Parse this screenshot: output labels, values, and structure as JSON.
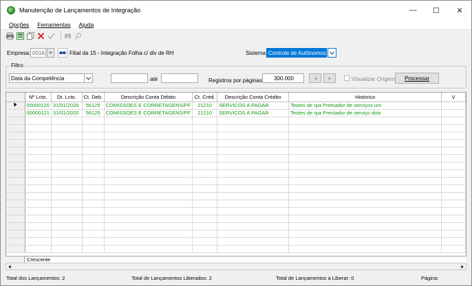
{
  "window": {
    "title": "Manutenção de Lançamentos de Integração",
    "minimize": "—",
    "maximize": "☐",
    "close": "✕"
  },
  "menu": [
    {
      "label": "Opções",
      "key": "O"
    },
    {
      "label": "Ferramentas",
      "key": "F"
    },
    {
      "label": "Ajuda",
      "key": "A"
    }
  ],
  "toolbar": {
    "icons": [
      "printer-icon",
      "export-icon",
      "copy-icon",
      "delete-icon",
      "confirm-icon",
      "binoculars-icon",
      "search-icon"
    ]
  },
  "empresa": {
    "label": "Empresa:",
    "code": "0016",
    "filial": "Filial da 15 - Integração Folha  c/ div de RH"
  },
  "sistema": {
    "label": "Sistema:",
    "value": "Controle de Autônomos"
  },
  "filtro": {
    "legend": "Filtro",
    "campo": "Data da Competência",
    "de": "",
    "ate_label": "até",
    "ate": "",
    "registros_label": "Registros por páginas:",
    "registros": "300.000",
    "visualizar_origem": "Visualizar Origem",
    "processar": "Processar"
  },
  "grid": {
    "columns": [
      "Nº Lcto.",
      "Dt. Lcto.",
      "Ct. Deb.",
      "Descrição Conta Débito",
      "Ct. Créd.",
      "Descrição Conta Crédito",
      "Histórico",
      "V"
    ],
    "rows": [
      [
        "00000120",
        "31/01/2020",
        "56125",
        "COMISSOES E CORRETAGENS/PF",
        "21210",
        "SERVICOS A PAGAR",
        "Testes de rpa  Pretsador de serviços um"
      ],
      [
        "00000121",
        "31/01/2020",
        "56125",
        "COMISSOES E CORRETAGENS/PF",
        "21210",
        "SERVICOS A PAGAR",
        "Testes de rpa  Prestador de serviço dois"
      ]
    ],
    "footer_label": "Crescente"
  },
  "status": {
    "total_lancamentos": "Total dos Lançamentos: 2",
    "total_liberados": "Total de Lançamentos Liberados: 2",
    "total_a_liberar": "Total de Lançamentos a Liberar: 0",
    "pagina": "Página:"
  }
}
